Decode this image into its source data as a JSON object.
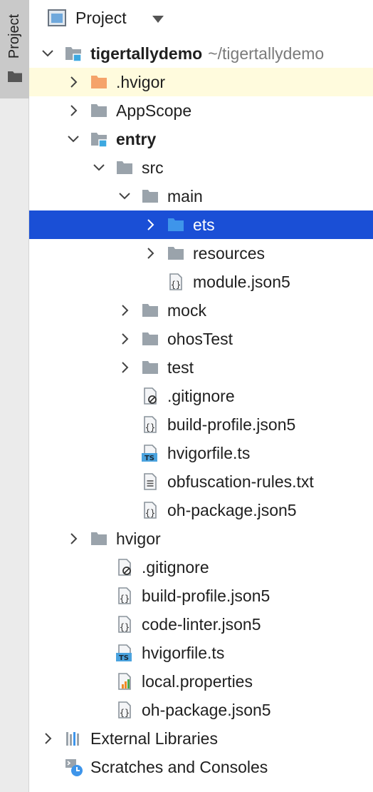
{
  "sidebar": {
    "tab_label": "Project"
  },
  "header": {
    "title": "Project"
  },
  "tree": {
    "rows": [
      {
        "label": "tigertallydemo",
        "sublabel": "~/tigertallydemo",
        "bold": true,
        "icon": "module-folder-icon",
        "expander": "expanded",
        "depth": 0,
        "highlighted": false,
        "selected": false
      },
      {
        "label": ".hvigor",
        "icon": "orange-folder-icon",
        "expander": "collapsed",
        "depth": 1,
        "highlighted": true,
        "selected": false
      },
      {
        "label": "AppScope",
        "icon": "folder-icon",
        "expander": "collapsed",
        "depth": 1,
        "highlighted": false,
        "selected": false
      },
      {
        "label": "entry",
        "bold": true,
        "icon": "module-folder-icon",
        "expander": "expanded",
        "depth": 1,
        "highlighted": false,
        "selected": false
      },
      {
        "label": "src",
        "icon": "folder-icon",
        "expander": "expanded",
        "depth": 2,
        "highlighted": false,
        "selected": false
      },
      {
        "label": "main",
        "icon": "folder-icon",
        "expander": "expanded",
        "depth": 3,
        "highlighted": false,
        "selected": false
      },
      {
        "label": "ets",
        "icon": "blue-folder-icon",
        "expander": "collapsed",
        "depth": 4,
        "highlighted": false,
        "selected": true
      },
      {
        "label": "resources",
        "icon": "folder-icon",
        "expander": "collapsed",
        "depth": 4,
        "highlighted": false,
        "selected": false
      },
      {
        "label": "module.json5",
        "icon": "json-file-icon",
        "expander": "none",
        "depth": 4,
        "highlighted": false,
        "selected": false
      },
      {
        "label": "mock",
        "icon": "folder-icon",
        "expander": "collapsed",
        "depth": 3,
        "highlighted": false,
        "selected": false
      },
      {
        "label": "ohosTest",
        "icon": "folder-icon",
        "expander": "collapsed",
        "depth": 3,
        "highlighted": false,
        "selected": false
      },
      {
        "label": "test",
        "icon": "folder-icon",
        "expander": "collapsed",
        "depth": 3,
        "highlighted": false,
        "selected": false
      },
      {
        "label": ".gitignore",
        "icon": "ignore-file-icon",
        "expander": "none",
        "depth": 3,
        "highlighted": false,
        "selected": false
      },
      {
        "label": "build-profile.json5",
        "icon": "json-file-icon",
        "expander": "none",
        "depth": 3,
        "highlighted": false,
        "selected": false
      },
      {
        "label": "hvigorfile.ts",
        "icon": "typescript-file-icon",
        "expander": "none",
        "depth": 3,
        "highlighted": false,
        "selected": false
      },
      {
        "label": "obfuscation-rules.txt",
        "icon": "text-file-icon",
        "expander": "none",
        "depth": 3,
        "highlighted": false,
        "selected": false
      },
      {
        "label": "oh-package.json5",
        "icon": "json-file-icon",
        "expander": "none",
        "depth": 3,
        "highlighted": false,
        "selected": false
      },
      {
        "label": "hvigor",
        "icon": "folder-icon",
        "expander": "collapsed",
        "depth": 1,
        "highlighted": false,
        "selected": false
      },
      {
        "label": ".gitignore",
        "icon": "ignore-file-icon",
        "expander": "none",
        "depth": 2,
        "highlighted": false,
        "selected": false
      },
      {
        "label": "build-profile.json5",
        "icon": "json-file-icon",
        "expander": "none",
        "depth": 2,
        "highlighted": false,
        "selected": false
      },
      {
        "label": "code-linter.json5",
        "icon": "json-file-icon",
        "expander": "none",
        "depth": 2,
        "highlighted": false,
        "selected": false
      },
      {
        "label": "hvigorfile.ts",
        "icon": "typescript-file-icon",
        "expander": "none",
        "depth": 2,
        "highlighted": false,
        "selected": false
      },
      {
        "label": "local.properties",
        "icon": "properties-file-icon",
        "expander": "none",
        "depth": 2,
        "highlighted": false,
        "selected": false
      },
      {
        "label": "oh-package.json5",
        "icon": "json-file-icon",
        "expander": "none",
        "depth": 2,
        "highlighted": false,
        "selected": false
      },
      {
        "label": "External Libraries",
        "icon": "libraries-icon",
        "expander": "collapsed",
        "depth": 0,
        "highlighted": false,
        "selected": false
      },
      {
        "label": "Scratches and Consoles",
        "icon": "scratches-icon",
        "expander": "none",
        "depth": 0,
        "highlighted": false,
        "selected": false
      }
    ]
  },
  "colors": {
    "selection": "#1a4fd6",
    "highlight_row": "#fffbdd",
    "folder_gray": "#9aa3ab",
    "folder_orange": "#f5a36a",
    "folder_blue": "#3e95ea",
    "module_square": "#3da8e0",
    "typescript_badge": "#4aa3df"
  }
}
